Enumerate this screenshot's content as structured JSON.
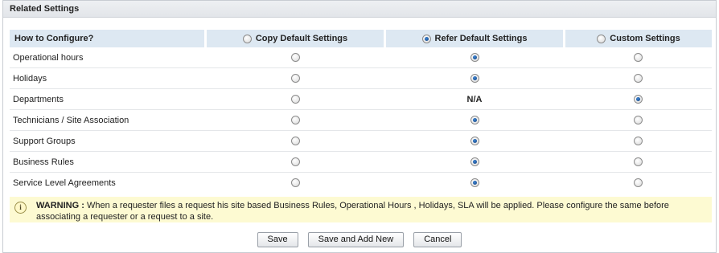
{
  "section": {
    "title": "Related Settings"
  },
  "table": {
    "headers": {
      "config": "How to Configure?",
      "copy": "Copy Default Settings",
      "refer": "Refer Default Settings",
      "custom": "Custom Settings"
    },
    "header_selected": "refer",
    "rows": [
      {
        "label": "Operational hours",
        "selected": "refer"
      },
      {
        "label": "Holidays",
        "selected": "refer"
      },
      {
        "label": "Departments",
        "selected": "custom",
        "refer_text": "N/A"
      },
      {
        "label": "Technicians / Site Association",
        "selected": "refer"
      },
      {
        "label": "Support Groups",
        "selected": "refer"
      },
      {
        "label": "Business Rules",
        "selected": "refer"
      },
      {
        "label": "Service Level Agreements",
        "selected": "refer"
      }
    ]
  },
  "warning": {
    "icon": "info-icon",
    "label": "WARNING :",
    "text": "When a requester files a request his site based Business Rules, Operational Hours , Holidays, SLA will be applied. Please configure the same before associating a requester or a request to a site."
  },
  "buttons": {
    "save": "Save",
    "save_add": "Save and Add New",
    "cancel": "Cancel"
  }
}
